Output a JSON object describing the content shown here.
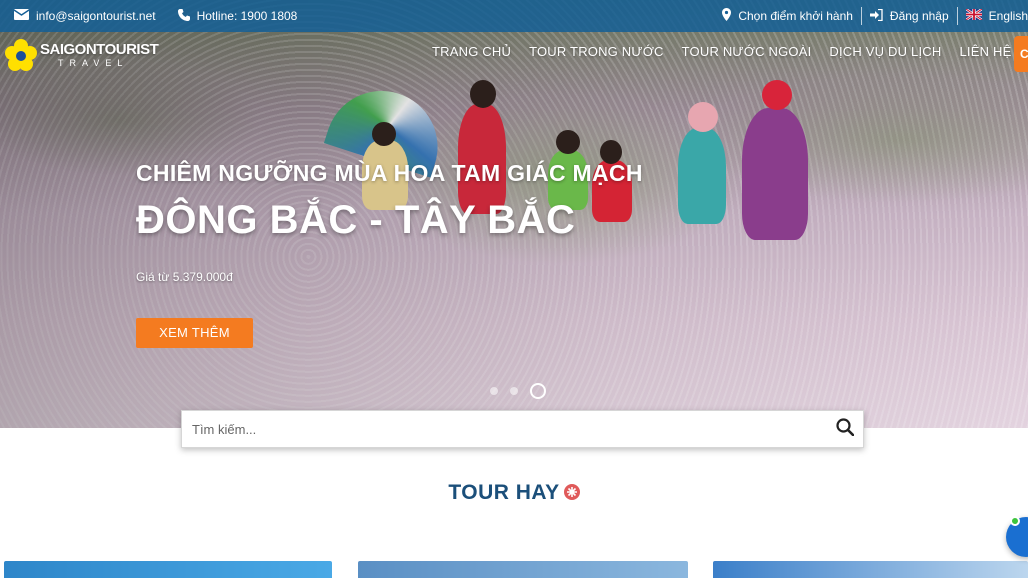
{
  "topbar": {
    "email": "info@saigontourist.net",
    "hotline": "Hotline: 1900 1808",
    "departure": "Chọn điểm khởi hành",
    "login": "Đăng nhập",
    "language": "English"
  },
  "logo": {
    "brand": "SAIGONTOURIST",
    "sub": "TRAVEL"
  },
  "nav": {
    "items": [
      "TRANG CHỦ",
      "TOUR TRONG NƯỚC",
      "TOUR NƯỚC NGOÀI",
      "DỊCH VỤ DU LỊCH",
      "LIÊN HỆ"
    ]
  },
  "slide": {
    "subtitle": "CHIÊM NGƯỠNG MÙA HOA TAM GIÁC MẠCH",
    "title": "ĐÔNG BẮC - TÂY BẮC",
    "price": "Giá từ 5.379.000đ",
    "cta": "XEM THÊM",
    "active_slide_index": 3,
    "slide_count": 3
  },
  "search": {
    "placeholder": "Tìm kiếm..."
  },
  "section": {
    "title": "TOUR HAY"
  },
  "colors": {
    "topbar": "#145f96",
    "accent": "#f47b20",
    "section_title": "#1b4f7a",
    "badge": "#e05a5a"
  },
  "icons": {
    "email": "envelope-icon",
    "phone": "phone-icon",
    "location": "map-marker-icon",
    "login": "sign-in-icon",
    "flag": "uk-flag-icon",
    "search": "search-icon"
  }
}
